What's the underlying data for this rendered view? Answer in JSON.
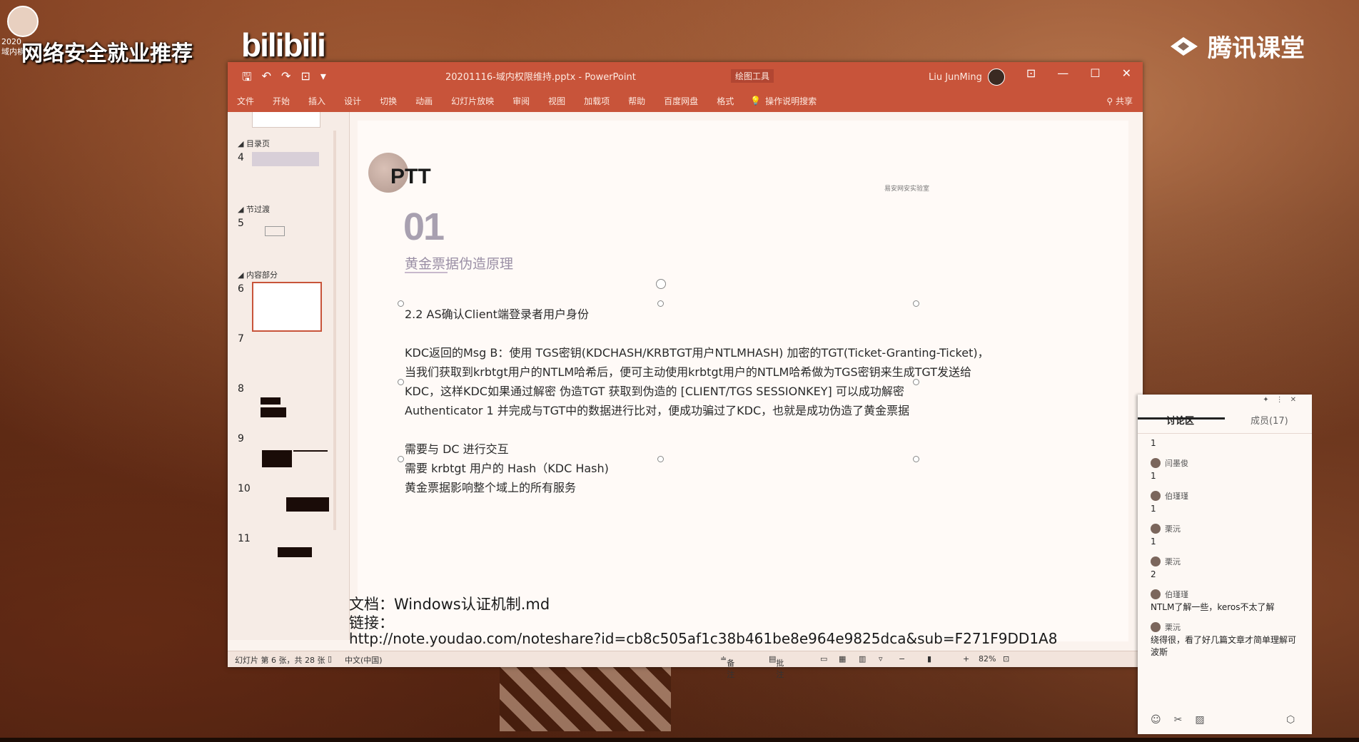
{
  "overlay": {
    "top_left_text": "2020\n域内横",
    "banner": "网络安全就业推荐",
    "bilibili": "bilibili",
    "tencent": "腾讯课堂"
  },
  "ppt": {
    "doc_title": "20201116-域内权限维持.pptx  -  PowerPoint",
    "context_tool": "绘图工具",
    "user_name": "Liu JunMing",
    "window_controls": [
      "⊡",
      "—",
      "☐",
      "✕"
    ],
    "ribbon_tabs": [
      "文件",
      "开始",
      "插入",
      "设计",
      "切换",
      "动画",
      "幻灯片放映",
      "审阅",
      "视图",
      "加载项",
      "帮助",
      "百度网盘",
      "格式"
    ],
    "tell_me": "操作说明搜索",
    "share": "共享",
    "sidebar": {
      "sections": [
        {
          "label": "目录页"
        },
        {
          "label": "节过渡"
        },
        {
          "label": "内容部分"
        }
      ],
      "slide_numbers": [
        "4",
        "5",
        "6",
        "7",
        "8",
        "9",
        "10",
        "11"
      ]
    },
    "slide": {
      "title": "PTT",
      "number": "01",
      "subtitle": "黄金票据伪造原理",
      "logo_text": "易安网安实验室",
      "lines": [
        "2.2 AS确认Client端登录者用户身份",
        "KDC返回的Msg B：使用 TGS密钥(KDCHASH/KRBTGT用户NTLMHASH) 加密的TGT(Ticket-Granting-Ticket)，",
        "当我们获取到krbtgt用户的NTLM哈希后，便可主动使用krbtgt用户的NTLM哈希做为TGS密钥来生成TGT发送给",
        "KDC，这样KDC如果通过解密 伪造TGT 获取到伪造的 [CLIENT/TGS SESSIONKEY] 可以成功解密",
        "Authenticator 1 并完成与TGT中的数据进行比对，便成功骗过了KDC，也就是成功伪造了黄金票据",
        "需要与 DC 进行交互",
        "需要 krbtgt 用户的 Hash（KDC Hash)",
        "黄金票据影响整个域上的所有服务"
      ],
      "doc_label": "文档：Windows认证机制.md",
      "link_label": "链接：",
      "link_url": "http://note.youdao.com/noteshare?id=cb8c505af1c38b461be8e964e9825dca&sub=F271F9DD1A8"
    },
    "status": {
      "slide_info": "幻灯片 第 6 张，共 28 张",
      "language": "中文(中国)",
      "notes": "备注",
      "comments": "批注",
      "zoom": "82%"
    }
  },
  "chat": {
    "tab_discussion": "讨论区",
    "tab_members": "成员(17)",
    "messages": [
      {
        "user": "",
        "text": "1"
      },
      {
        "user": "闫墨俊",
        "text": "1"
      },
      {
        "user": "伯瑾瑾",
        "text": "1"
      },
      {
        "user": "栗沅",
        "text": "1"
      },
      {
        "user": "栗沅",
        "text": "2"
      },
      {
        "user": "伯瑾瑾",
        "text": "NTLM了解一些，keros不太了解"
      },
      {
        "user": "栗沅",
        "text": "绕得很，看了好几篇文章才简单理解可波斯"
      }
    ]
  }
}
